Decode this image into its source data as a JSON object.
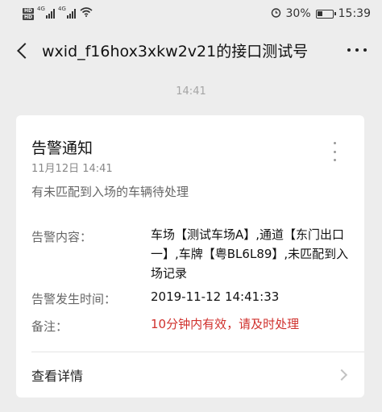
{
  "status_bar": {
    "hd_1": "HD",
    "hd_2": "HD",
    "net_1": "4G",
    "net_2": "4G",
    "battery": "30%",
    "time": "15:39"
  },
  "nav": {
    "title": "wxid_f16hox3xkw2v21的接口测试号"
  },
  "message_time": "14:41",
  "card": {
    "title": "告警通知",
    "date": "11月12日 14:41",
    "summary": "有未匹配到入场的车辆待处理",
    "rows": [
      {
        "label": "告警内容：",
        "value": "车场【测试车场A】,通道【东门出口一】,车牌【粤BL6L89】,未匹配到入场记录"
      },
      {
        "label": "告警发生时间：",
        "value": "2019-11-12 14:41:33"
      },
      {
        "label": "备注：",
        "value": "10分钟内有效，请及时处理"
      }
    ],
    "detail_label": "查看详情"
  },
  "colors": {
    "background": "#ededed",
    "card": "#ffffff",
    "remark_red": "#d0312d"
  }
}
